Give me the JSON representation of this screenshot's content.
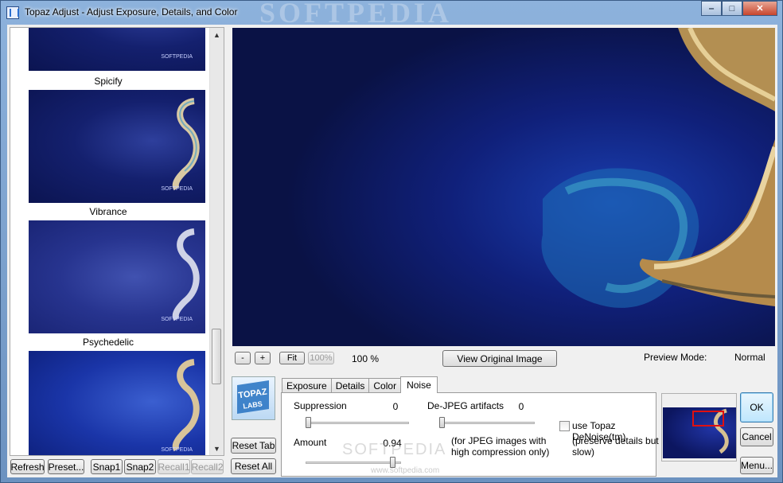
{
  "window": {
    "title": "Topaz Adjust - Adjust Exposure, Details, and Color",
    "watermark": "SOFTPEDIA",
    "controls": {
      "minimize": "‒",
      "maximize": "□",
      "close": "✕"
    }
  },
  "presets": {
    "items": [
      {
        "label": "Spicify"
      },
      {
        "label": "Vibrance"
      },
      {
        "label": "Psychedelic"
      }
    ],
    "thumb_watermark": "SOFTPEDIA",
    "scroll": {
      "up": "▲",
      "down": "▼"
    }
  },
  "left_toolbar": {
    "refresh": "Refresh",
    "preset": "Preset...",
    "snap1": "Snap1",
    "snap2": "Snap2",
    "recall1": "Recall1",
    "recall2": "Recall2"
  },
  "preview": {
    "zoom_out": "-",
    "zoom_in": "+",
    "fit": "Fit",
    "hundred": "100%",
    "zoom_level": "100 %",
    "view_original": "View Original Image",
    "mode_label": "Preview Mode:",
    "mode_value": "Normal"
  },
  "logo": {
    "line1": "TOPAZ",
    "line2": "LABS"
  },
  "reset": {
    "tab": "Reset Tab",
    "all": "Reset All"
  },
  "tabs": [
    {
      "label": "Exposure"
    },
    {
      "label": "Details"
    },
    {
      "label": "Color"
    },
    {
      "label": "Noise"
    }
  ],
  "active_tab": "Noise",
  "noise": {
    "suppression": {
      "label": "Suppression",
      "value": "0",
      "level": 0.0
    },
    "amount": {
      "label": "Amount",
      "value": "0.94",
      "level": 0.94
    },
    "dejpeg": {
      "label": "De-JPEG artifacts",
      "value": "0",
      "level": 0.0
    },
    "dejpeg_note": "(for JPEG images with high compression only)",
    "denoise": {
      "label": "use Topaz DeNoise(tm)",
      "checked": false
    },
    "denoise_note": "(preserve details but slow)"
  },
  "body_watermark": "SOFTPEDIA",
  "body_watermark_url": "www.softpedia.com",
  "actions": {
    "ok": "OK",
    "cancel": "Cancel",
    "menu": "Menu..."
  }
}
